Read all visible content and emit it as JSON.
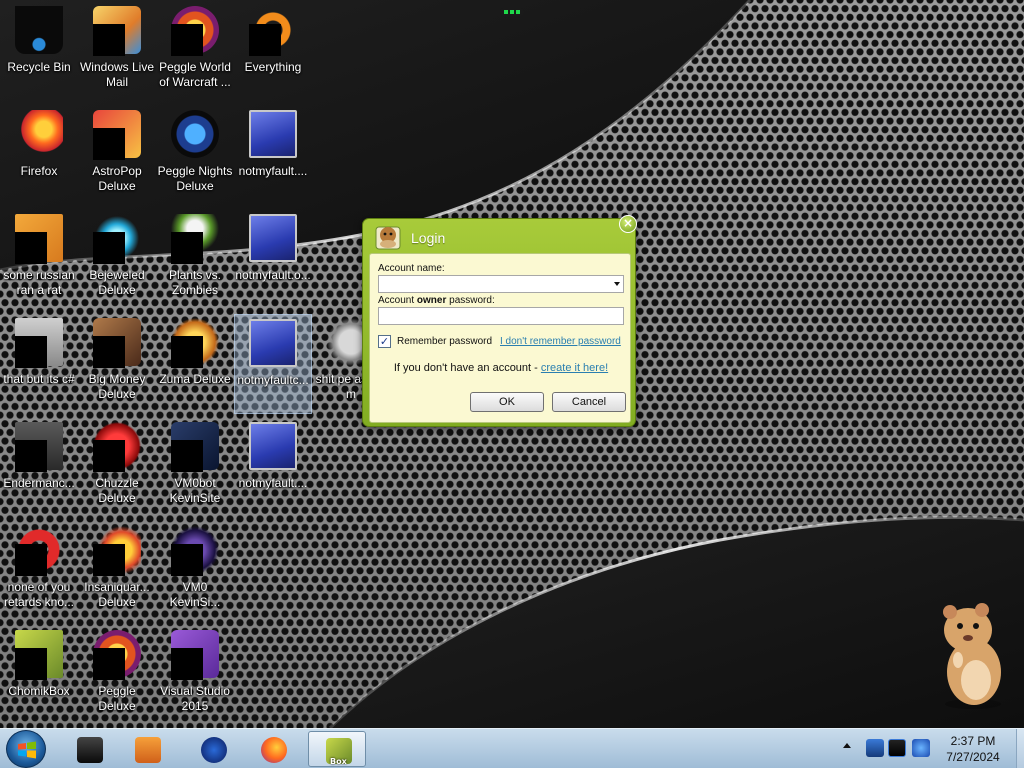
{
  "desktop": {
    "icons": [
      {
        "label": "Recycle Bin",
        "art": "art-bin",
        "icon": "recycle-bin-icon",
        "cover": false
      },
      {
        "label": "Windows Live Mail",
        "art": "art-mail",
        "icon": "mail-icon",
        "cover": true
      },
      {
        "label": "Peggle World of Warcraft ...",
        "art": "art-peggle",
        "icon": "peggle-icon",
        "cover": true
      },
      {
        "label": "Everything",
        "art": "art-every",
        "icon": "search-app-icon",
        "cover": true
      },
      {
        "label": "Firefox",
        "art": "art-ff",
        "icon": "firefox-icon",
        "cover": false
      },
      {
        "label": "AstroPop Deluxe",
        "art": "art-astro",
        "icon": "game-icon",
        "cover": true
      },
      {
        "label": "Peggle Nights Deluxe",
        "art": "art-peggle2",
        "icon": "peggle-icon",
        "cover": false
      },
      {
        "label": "notmyfault....",
        "art": "art-blue",
        "icon": "shortcut-icon",
        "cover": false
      },
      {
        "label": "some russian ran a rat",
        "art": "art-doc",
        "icon": "document-icon",
        "cover": true
      },
      {
        "label": "Bejeweled Deluxe",
        "art": "art-gem",
        "icon": "gem-icon",
        "cover": true
      },
      {
        "label": "Plants vs. Zombies",
        "art": "art-plant",
        "icon": "plant-icon",
        "cover": true
      },
      {
        "label": "notmyfault.o...",
        "art": "art-blue",
        "icon": "shortcut-icon",
        "cover": false
      },
      {
        "label": "that but its c#",
        "art": "art-stack",
        "icon": "file-icon",
        "cover": true
      },
      {
        "label": "Big Money Deluxe",
        "art": "art-money",
        "icon": "game-icon",
        "cover": true
      },
      {
        "label": "Zuma Deluxe",
        "art": "art-zuma",
        "icon": "zuma-icon",
        "cover": true
      },
      {
        "label": "notmyfaultc...",
        "art": "art-blue",
        "icon": "shortcut-icon",
        "cover": false,
        "selected": true
      },
      {
        "label": "shit pe asked m",
        "art": "art-ghost",
        "icon": "file-icon",
        "cover": false
      },
      {
        "label": "Endermanc...",
        "art": "art-folder",
        "icon": "folder-icon",
        "cover": true
      },
      {
        "label": "Chuzzle Deluxe",
        "art": "art-red",
        "icon": "game-icon",
        "cover": true
      },
      {
        "label": "VM0bot KevinSite",
        "art": "art-vm",
        "icon": "vm-icon",
        "cover": true
      },
      {
        "label": "notmyfault....",
        "art": "art-blue",
        "icon": "shortcut-icon",
        "cover": false
      },
      {
        "label": "none of you retards kno...",
        "art": "art-opera",
        "icon": "browser-icon",
        "cover": true
      },
      {
        "label": "Insaniquar... Deluxe",
        "art": "art-bird",
        "icon": "game-icon",
        "cover": true
      },
      {
        "label": "VM0 KevinSi...",
        "art": "art-vm2",
        "icon": "vm-icon",
        "cover": true
      },
      {
        "label": "ChomikBox",
        "art": "art-hamster",
        "icon": "hamster-icon",
        "cover": true
      },
      {
        "label": "Peggle Deluxe",
        "art": "art-peggle",
        "icon": "peggle-icon",
        "cover": true
      },
      {
        "label": "Visual Studio 2015",
        "art": "art-vs",
        "icon": "visual-studio-icon",
        "cover": true
      }
    ]
  },
  "dialog": {
    "title": "Login",
    "close_glyph": "×",
    "account_name_label": "Account name:",
    "account_name_value": "",
    "password_label_pre": "Account ",
    "password_label_bold": "owner",
    "password_label_post": " password:",
    "password_value": "",
    "remember_label": "Remember password",
    "remember_checked": true,
    "forgot_link": "I don't remember password",
    "no_account_text": "If you don't have an account - ",
    "create_link": "create it here!",
    "ok_label": "OK",
    "cancel_label": "Cancel",
    "accent": "#8db82a"
  },
  "taskbar": {
    "clock_time": "2:37 PM",
    "clock_date": "7/27/2024",
    "pinned": [
      {
        "name": "taskbar-app-dark",
        "icon": "monitor-icon"
      },
      {
        "name": "taskbar-app-media",
        "icon": "media-player-icon"
      },
      {
        "name": "taskbar-app-globe",
        "icon": "globe-icon"
      },
      {
        "name": "taskbar-app-firefox",
        "icon": "firefox-icon"
      },
      {
        "name": "taskbar-app-chomikbox",
        "icon": "hamster-icon",
        "active": true
      }
    ],
    "active_badge": "Box"
  }
}
